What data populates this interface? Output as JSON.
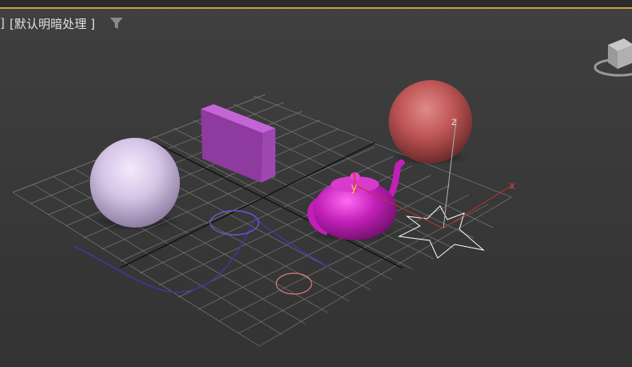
{
  "viewport": {
    "label_left_bracket": "]",
    "label_shading": "[默认明暗处理 ]",
    "filter_icon": "filter-icon",
    "axis_z": "z",
    "axis_x": "x",
    "axis_y": "y"
  },
  "colors": {
    "accent_top_border": "#c8a23a",
    "background": "#3a3a3a",
    "grid": "#8a8a8a",
    "sphere_lavender": "#d6c4e6",
    "box_magenta": "#b14fc4",
    "sphere_red": "#c05656",
    "teapot_magenta": "#c21fb8",
    "star_outline": "#ffffff",
    "spline_blue": "#3a3aa0",
    "circle_blue": "#6a5acd",
    "circle_pink": "#e07a7a",
    "axis_x_color": "#c03030",
    "axis_z_color": "#b0b0b0"
  }
}
